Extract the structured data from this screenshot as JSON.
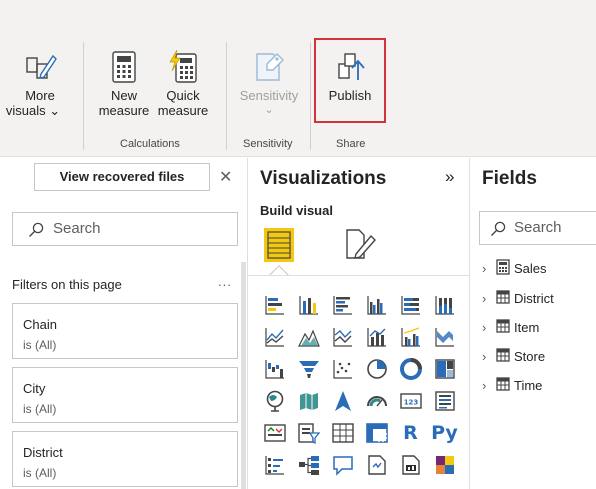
{
  "ribbon": {
    "more_visuals": {
      "line1": "More",
      "line2": "visuals ⌄",
      "icon": "more-visuals-icon"
    },
    "new_measure": {
      "line1": "New",
      "line2": "measure",
      "icon": "calculator-icon"
    },
    "quick_measure": {
      "line1": "Quick",
      "line2": "measure",
      "icon": "quick-measure-icon"
    },
    "sensitivity": {
      "label": "Sensitivity",
      "chevron": "⌄",
      "icon": "sensitivity-icon"
    },
    "publish": {
      "label": "Publish",
      "icon": "publish-icon",
      "highlight_color": "#d13438"
    },
    "groups": {
      "calculations": "Calculations",
      "sensitivity": "Sensitivity",
      "share": "Share"
    }
  },
  "filters": {
    "recovered_button": "View recovered files",
    "close": "✕",
    "search_placeholder": "Search",
    "title": "Filters on this page",
    "more": "...",
    "cards": [
      {
        "field": "Chain",
        "value": "is (All)"
      },
      {
        "field": "City",
        "value": "is (All)"
      },
      {
        "field": "District",
        "value": "is (All)"
      }
    ]
  },
  "visualizations": {
    "title": "Visualizations",
    "expand": "»",
    "build_label": "Build visual",
    "text_icons": {
      "r": "R",
      "py": "Py"
    },
    "icons": [
      "stacked-bar-chart-icon",
      "stacked-column-chart-icon",
      "clustered-bar-chart-icon",
      "clustered-column-chart-icon",
      "100pct-stacked-bar-chart-icon",
      "100pct-stacked-column-chart-icon",
      "line-chart-icon",
      "area-chart-icon",
      "stacked-area-chart-icon",
      "line-and-stacked-column-icon",
      "line-and-clustered-column-icon",
      "ribbon-chart-icon",
      "waterfall-chart-icon",
      "funnel-chart-icon",
      "scatter-chart-icon",
      "pie-chart-icon",
      "donut-chart-icon",
      "treemap-icon",
      "map-icon",
      "filled-map-icon",
      "azure-map-icon",
      "gauge-icon",
      "card-icon",
      "multi-row-card-icon",
      "kpi-icon",
      "slicer-icon",
      "table-icon",
      "matrix-icon",
      "r-script-visual-icon",
      "python-visual-icon",
      "key-influencers-icon",
      "decomposition-tree-icon",
      "qa-icon",
      "smart-narrative-icon",
      "paginated-report-icon",
      "power-apps-icon"
    ]
  },
  "fields": {
    "title": "Fields",
    "search_placeholder": "Search",
    "items": [
      {
        "name": "Sales",
        "icon": "measure-table-icon"
      },
      {
        "name": "District",
        "icon": "table-icon"
      },
      {
        "name": "Item",
        "icon": "table-icon"
      },
      {
        "name": "Store",
        "icon": "table-icon"
      },
      {
        "name": "Time",
        "icon": "table-icon"
      }
    ]
  },
  "colors": {
    "accent_yellow": "#f2c811",
    "accent_blue": "#2b6cb8",
    "ribbon_bg": "#f3f2f1",
    "publish_outline": "#d13438"
  }
}
